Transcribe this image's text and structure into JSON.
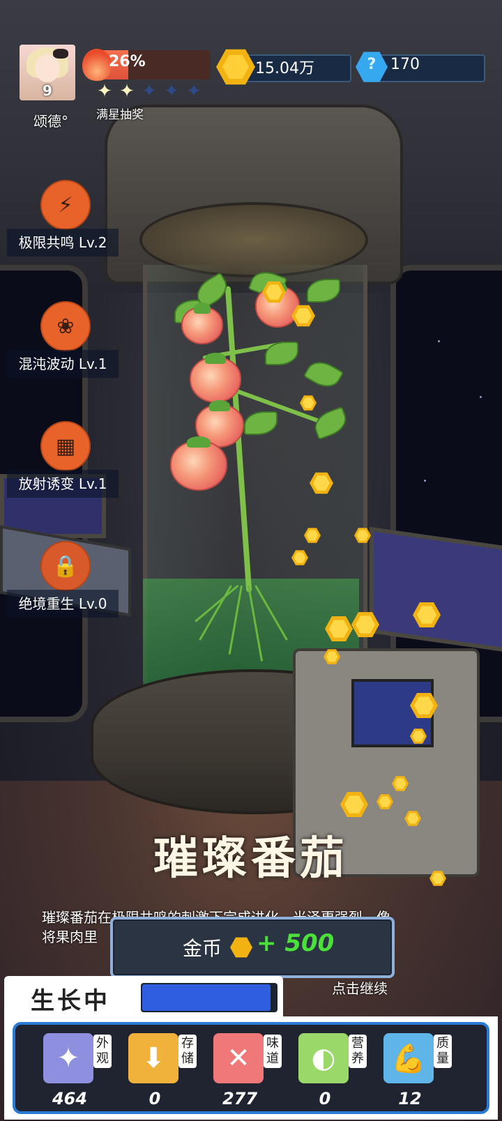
{
  "player": {
    "level": "9",
    "name": "颂德°"
  },
  "energy": {
    "percent_text": "26%",
    "fill_fraction": 0.26
  },
  "stars": {
    "filled": 2,
    "total": 5
  },
  "lucky_draw_label": "满星抽奖",
  "resources": {
    "gold": "15.04万",
    "gems": "170"
  },
  "skills": [
    {
      "label": "极限共鸣 Lv.2",
      "icon": "lightning-plant-icon"
    },
    {
      "label": "混沌波动 Lv.1",
      "icon": "chaos-jar-icon"
    },
    {
      "label": "放射诱变 Lv.1",
      "icon": "mutation-box-icon"
    },
    {
      "label": "绝境重生 Lv.0",
      "icon": "lock-icon"
    }
  ],
  "item": {
    "title": "璀璨番茄",
    "description_line1": "璀璨番茄在极限共鸣的刺激下完成进化，光泽更强烈，像",
    "description_line2": "将果肉里"
  },
  "reward": {
    "label": "金币",
    "amount": "+ 500"
  },
  "continue_label": "点击继续",
  "growth": {
    "status_label": "生长中",
    "progress_fraction": 0.96
  },
  "stats": [
    {
      "tag": "外观",
      "value": "464",
      "icon": "sparkle-icon",
      "color": "#8f8fe0"
    },
    {
      "tag": "存储",
      "value": "0",
      "icon": "box-icon",
      "color": "#f0b23a"
    },
    {
      "tag": "味道",
      "value": "277",
      "icon": "fork-knife-icon",
      "color": "#f07878"
    },
    {
      "tag": "营养",
      "value": "0",
      "icon": "lemon-icon",
      "color": "#9ad86a"
    },
    {
      "tag": "质量",
      "value": "12",
      "icon": "muscle-icon",
      "color": "#5fb4e8"
    }
  ],
  "colors": {
    "accent": "#e8632a",
    "reward_green": "#4ce03a",
    "progress_blue": "#2f5ee0"
  }
}
